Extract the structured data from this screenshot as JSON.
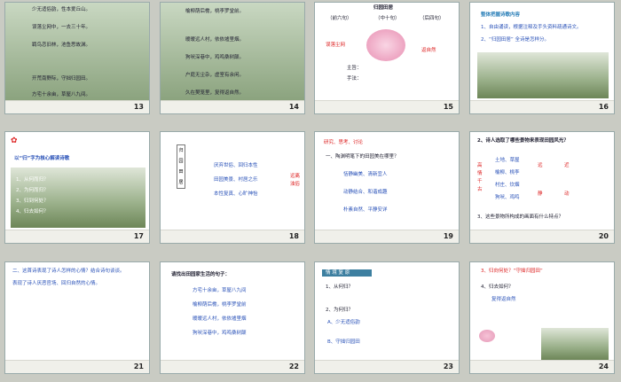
{
  "slides": [
    {
      "num": "13",
      "lines": [
        "少无适俗韵，性本爱丘山。",
        "误落尘网中，一去三十年。",
        "羁鸟恋旧林，池鱼思故渊。",
        "开荒南野际，守拙归园田。",
        "方宅十余亩，草屋八九间。"
      ]
    },
    {
      "num": "14",
      "lines": [
        "榆柳荫后檐，桃李罗堂前。",
        "暧暧远人村，依依墟里烟。",
        "狗吠深巷中，鸡鸣桑树颠。",
        "户庭无尘杂，虚室有余闲。",
        "久在樊笼里，复得返自然。"
      ]
    },
    {
      "num": "15",
      "title": "归园田居",
      "heads": [
        "（前六句）",
        "（中十句）",
        "（后四句）"
      ],
      "words": [
        "误落尘网",
        "返自然",
        "主旨：",
        "手法："
      ]
    },
    {
      "num": "16",
      "title": "整体把握诗歌内容",
      "lines": [
        "1、自由诵读，根据注释及手头资料疏通诗文。",
        "2、“归园田居”   全诗是怎样分。"
      ]
    },
    {
      "num": "17",
      "title": "以“归”字为核心解读诗歌",
      "lines": [
        "1、从何而归？",
        "2、为何而归？",
        "3、归到何处？",
        "4、归去如何？"
      ]
    },
    {
      "num": "18",
      "side": "归园田居",
      "items": [
        "厌弃世俗、回归本性",
        "田园美景、村居之乐",
        "本性复真、心旷神怡"
      ],
      "right": "远离浊俗"
    },
    {
      "num": "19",
      "head": "研究、思考、讨论",
      "q": "一、陶渊明笔下的田园美在哪里？",
      "a": [
        "恬静幽美、清新宜人",
        "动静结合、和谐成趣",
        "朴素自然、平静安详"
      ]
    },
    {
      "num": "20",
      "title": "2、诗人选取了哪些景物来表现田园风光？",
      "left": "高情千古",
      "rows": [
        "土地、草屋",
        "榆柳、桃李",
        "村庄、炊烟",
        "狗吠、鸡鸣"
      ],
      "cols": [
        "远",
        "近",
        "静",
        "动"
      ],
      "foot": "3、这些景物所构成的画面有什么特点？"
    },
    {
      "num": "21",
      "lines": [
        "二、这首诗表现了诗人怎样的心情？结合诗句谈谈。",
        "表现了诗人厌恶官场、回归自然的心情。"
      ]
    },
    {
      "num": "22",
      "title": "请找出田园家生活的句子：",
      "lines": [
        "方宅十余亩，草屋八九间",
        "榆柳荫后檐，桃李罗堂前",
        "暧暧远人村，依依墟里烟",
        "狗吠深巷中，鸡鸣桑树颠"
      ]
    },
    {
      "num": "23",
      "title": "情 境 复 原",
      "lines": [
        "1、从何归？",
        "2、为何归？",
        "A、少无适俗韵",
        "B、守拙归园田"
      ]
    },
    {
      "num": "24",
      "lines": [
        "3、归向何处？“守拙归园田”",
        "4、归去如何？",
        "复得返自然"
      ]
    }
  ]
}
